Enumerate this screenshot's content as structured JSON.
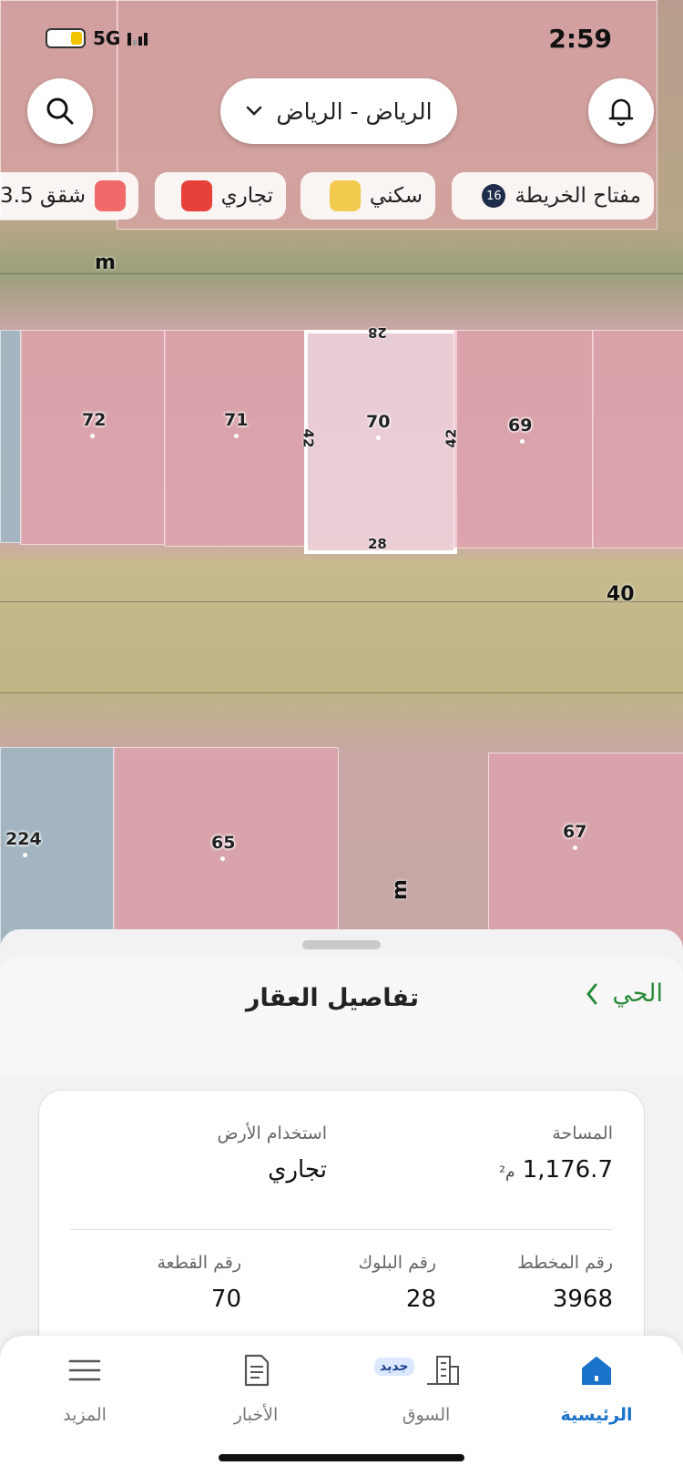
{
  "status_bar": {
    "time": "2:59",
    "network": "5G"
  },
  "top_bar": {
    "city": "الرياض - الرياض"
  },
  "map_key": {
    "label": "مفتاح الخريطة",
    "count": "16",
    "items": [
      {
        "label": "سكني",
        "color": "#f2cb4e"
      },
      {
        "label": "تجاري",
        "color": "#e8413a"
      },
      {
        "label": "شقق 3.5",
        "color": "#f06a6a"
      }
    ]
  },
  "map": {
    "parcels": [
      {
        "num": "72"
      },
      {
        "num": "71"
      },
      {
        "num": "70",
        "selected": true
      },
      {
        "num": "69"
      },
      {
        "num": "224"
      },
      {
        "num": "65"
      },
      {
        "num": "67"
      }
    ],
    "dims": {
      "top": "28",
      "bottom": "28",
      "left": "42",
      "right": "42"
    },
    "road_labels": {
      "road_width": "40",
      "m_top": "m",
      "m_bottom": "m"
    }
  },
  "sheet": {
    "title": "تفاصيل العقار",
    "neighborhood_link": "الحي",
    "area_label": "المساحة",
    "area_value": "1,176.7",
    "area_unit": "م²",
    "land_use_label": "استخدام الأرض",
    "land_use_value": "تجاري",
    "plan_label": "رقم المخطط",
    "plan_value": "3968",
    "block_label": "رقم البلوك",
    "block_value": "28",
    "plot_label": "رقم القطعة",
    "plot_value": "70"
  },
  "tabbar": {
    "home": "الرئيسية",
    "market": "السوق",
    "market_badge": "جديد",
    "news": "الأخبار",
    "more": "المزيد"
  },
  "colors": {
    "accent": "#1a73c9",
    "green": "#2a8a3a"
  }
}
